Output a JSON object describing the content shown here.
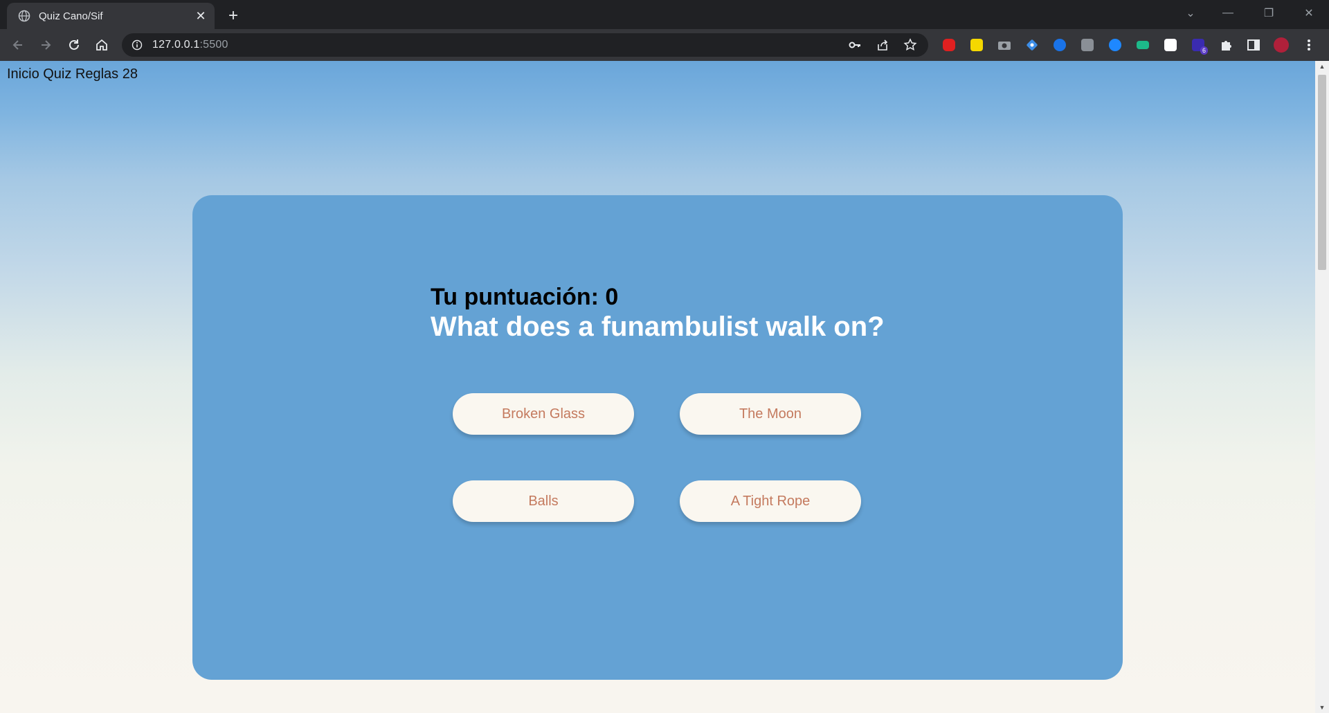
{
  "browser": {
    "tab_title": "Quiz Cano/Sif",
    "url_host": "127.0.0.1",
    "url_port": ":5500",
    "extension_badge": "6"
  },
  "page": {
    "nav_link": "Inicio Quiz Reglas 28",
    "score_text": "Tu puntuación: 0",
    "question": "What does a funambulist walk on?",
    "answers": [
      "Broken Glass",
      "The Moon",
      "Balls",
      "A Tight Rope"
    ]
  },
  "colors": {
    "card": "#64a2d4",
    "answer_bg": "#faf7f0",
    "answer_text": "#c47a5e"
  }
}
